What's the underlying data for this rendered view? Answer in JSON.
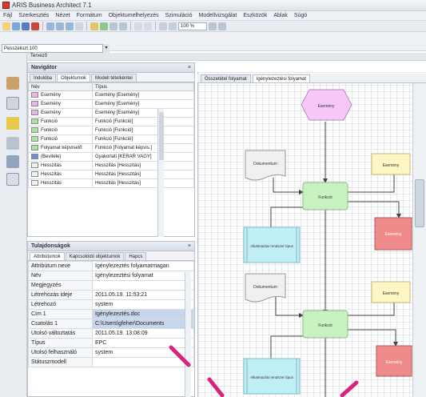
{
  "window": {
    "title": "ARIS Business Architect 7.1"
  },
  "menu": [
    "Fájl",
    "Szerkesztés",
    "Nézet",
    "Formátum",
    "Objektumelhelyezés",
    "Szimuláció",
    "Modellvizsgálat",
    "Eszközök",
    "Ablak",
    "Súgó"
  ],
  "toolbar": {
    "zoom": "100 %"
  },
  "combo": {
    "value": "Pesszeliszt 100"
  },
  "workspace": {
    "label": "Tervező"
  },
  "nav_panel": {
    "title": "Navigátor",
    "tabs": [
      "Indulóba",
      "Objektumok",
      "Modell tételkéntei"
    ],
    "columns": [
      "Név",
      "Típus"
    ],
    "rows": [
      {
        "name": "Esemény",
        "type": "Esemény [Esemény]",
        "color": "#e9b6ec"
      },
      {
        "name": "Esemény",
        "type": "Esemény [Esemény]",
        "color": "#e9b6ec"
      },
      {
        "name": "Esemény",
        "type": "Esemény [Esemény]",
        "color": "#e9b6ec"
      },
      {
        "name": "Funkció",
        "type": "Funkció [Funkció]",
        "color": "#a8e5a0"
      },
      {
        "name": "Funkció",
        "type": "Funkció [Funkció]",
        "color": "#a8e5a0"
      },
      {
        "name": "Funkció",
        "type": "Funkció [Funkció]",
        "color": "#a8e5a0"
      },
      {
        "name": "Folyamat képviselő",
        "type": "Funkció [Folyamat képvis.]",
        "color": "#a8e5a0"
      },
      {
        "name": "(Bevitele)",
        "type": "Gyakorlati [KERAR VAGY]",
        "color": "#6b8fd8"
      },
      {
        "name": "Hesszitás",
        "type": "Hesszitás [Hesszitás]",
        "color": "#f2f2f2"
      },
      {
        "name": "Hesszitás",
        "type": "Hesszitás [Hesszitás]",
        "color": "#f2f2f2"
      },
      {
        "name": "Hesszitás",
        "type": "Hesszitás [Hesszitás]",
        "color": "#f2f2f2"
      }
    ]
  },
  "attr_panel": {
    "title": "Tulajdonságok",
    "tabs": [
      "Attribútumok",
      "Kapcsolódó objektumok",
      "Hapcs"
    ],
    "rows": [
      {
        "k": "Attribútum neve",
        "v": "Igénylezeztés folyamatmagan"
      },
      {
        "k": "Név",
        "v": "Igénylezeztési folyamat"
      },
      {
        "k": "Megjegyzés",
        "v": ""
      },
      {
        "k": "Létrehozás ideje",
        "v": "2011.05.19. 11:53:21"
      },
      {
        "k": "Létrehozó",
        "v": "system"
      },
      {
        "k": "Cím 1",
        "v": "Igénylezeztés.doc"
      },
      {
        "k": "Csatolás 1",
        "v": "C:\\Users\\gfeher\\Documents"
      },
      {
        "k": "Utolsó változtatás",
        "v": "2011.05.19. 13:08:09"
      },
      {
        "k": "Típus",
        "v": "EPC"
      },
      {
        "k": "Utolsó felhasználó",
        "v": "system"
      },
      {
        "k": "Státuszmodell",
        "v": ""
      }
    ]
  },
  "doc_tabs": [
    "Összetétel folyamat",
    "Igénylezeztési folyamat"
  ],
  "diagram": {
    "start_event": "Esemény",
    "doc1": "Dokumentum",
    "func1": "Funkció",
    "event_right1": "Esemény",
    "event_red1": "Esemény",
    "sys1": "Alkalmazási rendszer típus",
    "doc2": "Dokumentum",
    "func2": "Funkció",
    "event_right2": "Esemény",
    "event_red2": "Esemény",
    "sys2": "Alkalmazási rendszer típus"
  },
  "colors": {
    "event": "#f6c7f7",
    "function": "#c8f2c0",
    "doc": "#f0f0f0",
    "sys": "#bfeef7",
    "right": "#fff6c6",
    "red": "#f08b8b",
    "accent": "#d9247c"
  }
}
